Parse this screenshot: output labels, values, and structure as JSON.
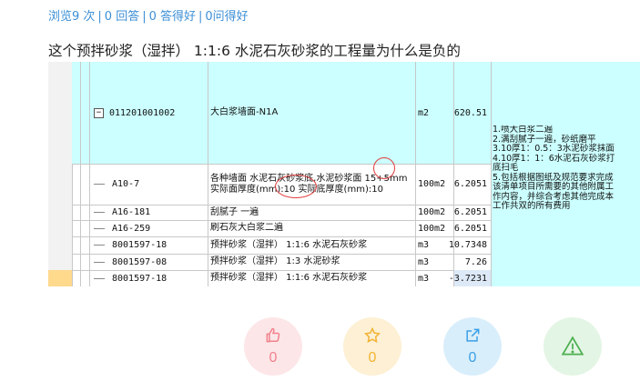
{
  "stats": {
    "views": "浏览9 次",
    "answers": "0 回答",
    "good_answers": "0 答得好",
    "good_questions": "0问得好",
    "separator": "|"
  },
  "question": {
    "title": "这个预拌砂浆（湿拌） 1:1:6 水泥石灰砂浆的工程量为什么是负的"
  },
  "table": {
    "rows": [
      {
        "code": "011201001002",
        "name": "大白浆墙面-N1A",
        "unit": "m2",
        "qty": "620.51",
        "expander": "−"
      },
      {
        "code": "A10-7",
        "name": "各种墙面 水泥石灰砂浆底,水泥砂浆面 15+5mm 实际面厚度(mm):10 实际底厚度(mm):10",
        "unit": "100m2",
        "qty": "6.2051"
      },
      {
        "code": "A16-181",
        "name": "刮腻子 一遍",
        "unit": "100m2",
        "qty": "6.2051"
      },
      {
        "code": "A16-259",
        "name": "刷石灰大白浆二遍",
        "unit": "100m2",
        "qty": "6.2051"
      },
      {
        "code": "8001597-18",
        "name": "预拌砂浆（湿拌） 1:1:6 水泥石灰砂浆",
        "unit": "m3",
        "qty": "10.7348"
      },
      {
        "code": "8001597-08",
        "name": "预拌砂浆（湿拌） 1:3 水泥砂浆",
        "unit": "m3",
        "qty": "7.26"
      },
      {
        "code": "8001597-18",
        "name": "预拌砂浆（湿拌） 1:1:6 水泥石灰砂浆",
        "unit": "m3",
        "qty": "-3.7231"
      }
    ],
    "side_notes": [
      "1.喷大白浆二遍",
      "2.满刮腻子一遍，砂纸磨平",
      "3.10厚1：0.5：3水泥砂浆抹面",
      "4.10厚1：1：6水泥石灰砂浆打",
      "底扫毛",
      "5.包括根据图纸及规范要求完成",
      "该清单项目所需要的其他附属工",
      "作内容，并综合考虑其他完成本",
      "工作共双的所有费用"
    ]
  },
  "actions": {
    "like_count": "0",
    "favorite_count": "0",
    "share_count": "0",
    "colors": {
      "like": "#fde6e8",
      "favorite": "#fdf0d4",
      "share": "#d9eefb",
      "report": "#e3f5e4",
      "like_icon": "#f0828c",
      "favorite_icon": "#f2b233",
      "share_icon": "#3aa0e6",
      "report_icon": "#4caf50"
    }
  }
}
